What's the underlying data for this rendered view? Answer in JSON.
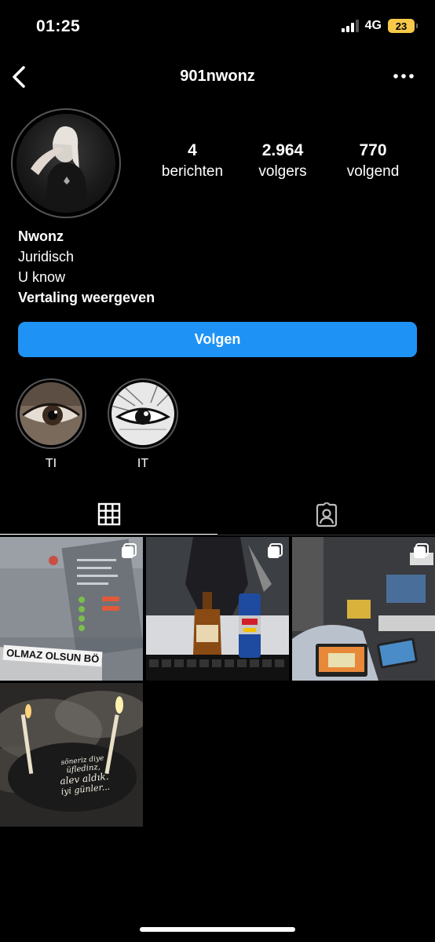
{
  "status": {
    "time": "01:25",
    "network": "4G",
    "battery": "23",
    "battery_color": "#f7c948"
  },
  "header": {
    "username": "901nwonz",
    "back_icon": "chevron-left-icon",
    "more_icon": "more-horizontal-icon"
  },
  "profile": {
    "stats": [
      {
        "value": "4",
        "label": "berichten"
      },
      {
        "value": "2.964",
        "label": "volgers"
      },
      {
        "value": "770",
        "label": "volgend"
      }
    ],
    "name": "Nwonz",
    "bio_lines": [
      "Juridisch",
      "U know"
    ],
    "translate_label": "Vertaling weergeven",
    "follow_label": "Volgen",
    "follow_color": "#1f93f5"
  },
  "highlights": [
    {
      "label": "TI"
    },
    {
      "label": "IT"
    }
  ],
  "tabs": [
    {
      "icon": "grid-icon",
      "active": true
    },
    {
      "icon": "tagged-person-icon",
      "active": false
    }
  ],
  "posts": [
    {
      "overlay_text": "OLMAZ OLSUN BÖ",
      "multi": true
    },
    {
      "multi": true
    },
    {
      "multi": true
    },
    {
      "cake_text": [
        "söneriz diye",
        "üfledinz,",
        "alev aldık.",
        "iyi günler..."
      ],
      "multi": false
    }
  ]
}
